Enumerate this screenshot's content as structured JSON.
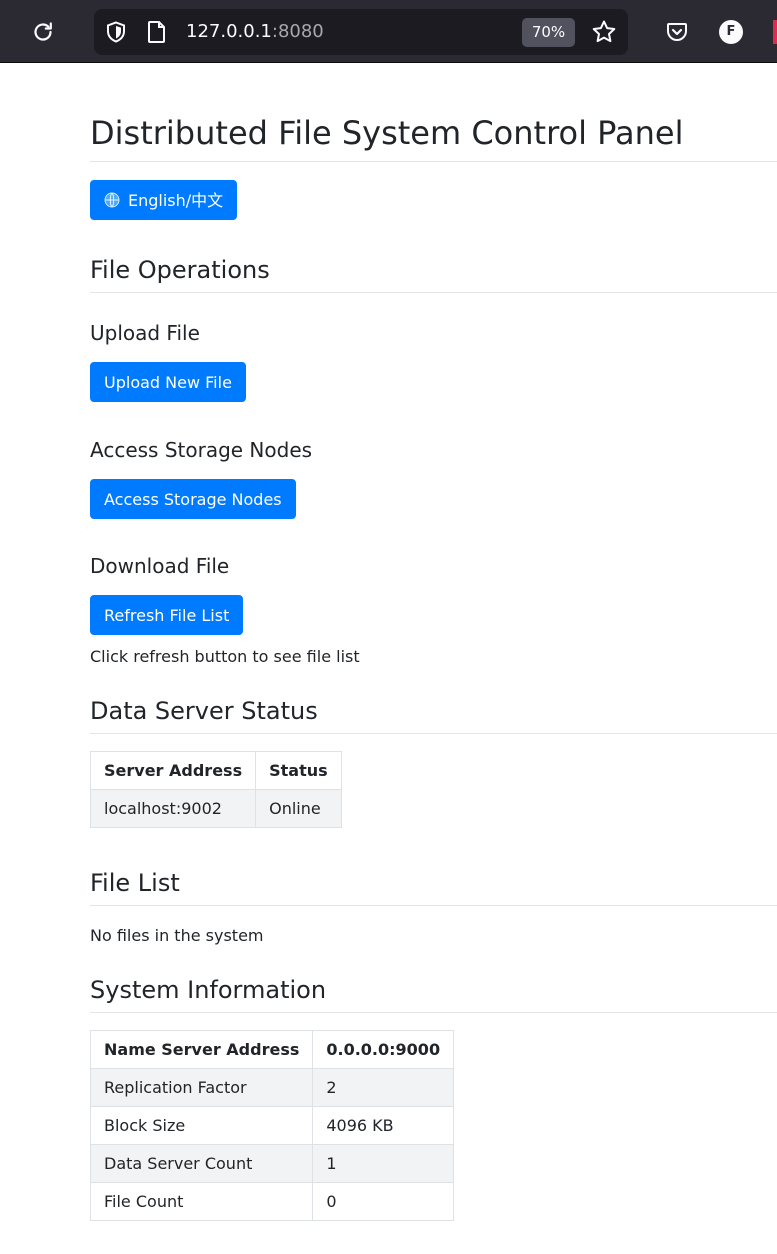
{
  "browser": {
    "url_host": "127.0.0.1",
    "url_port": ":8080",
    "zoom": "70%",
    "profile_initial": "F"
  },
  "page": {
    "title": "Distributed File System Control Panel",
    "language_button": "English/中文",
    "file_operations_heading": "File Operations",
    "upload": {
      "heading": "Upload File",
      "button": "Upload New File"
    },
    "storage": {
      "heading": "Access Storage Nodes",
      "button": "Access Storage Nodes"
    },
    "download": {
      "heading": "Download File",
      "button": "Refresh File List",
      "hint": "Click refresh button to see file list"
    },
    "data_server_status": {
      "heading": "Data Server Status",
      "columns": [
        "Server Address",
        "Status"
      ],
      "rows": [
        {
          "address": "localhost:9002",
          "status": "Online"
        }
      ]
    },
    "file_list": {
      "heading": "File List",
      "empty_text": "No files in the system"
    },
    "system_info": {
      "heading": "System Information",
      "rows": [
        {
          "label": "Name Server Address",
          "value": "0.0.0.0:9000"
        },
        {
          "label": "Replication Factor",
          "value": "2"
        },
        {
          "label": "Block Size",
          "value": "4096 KB"
        },
        {
          "label": "Data Server Count",
          "value": "1"
        },
        {
          "label": "File Count",
          "value": "0"
        }
      ]
    }
  },
  "colors": {
    "primary": "#007bff",
    "toolbar_bg": "#2b2a33",
    "urlbar_bg": "#1c1b22"
  }
}
